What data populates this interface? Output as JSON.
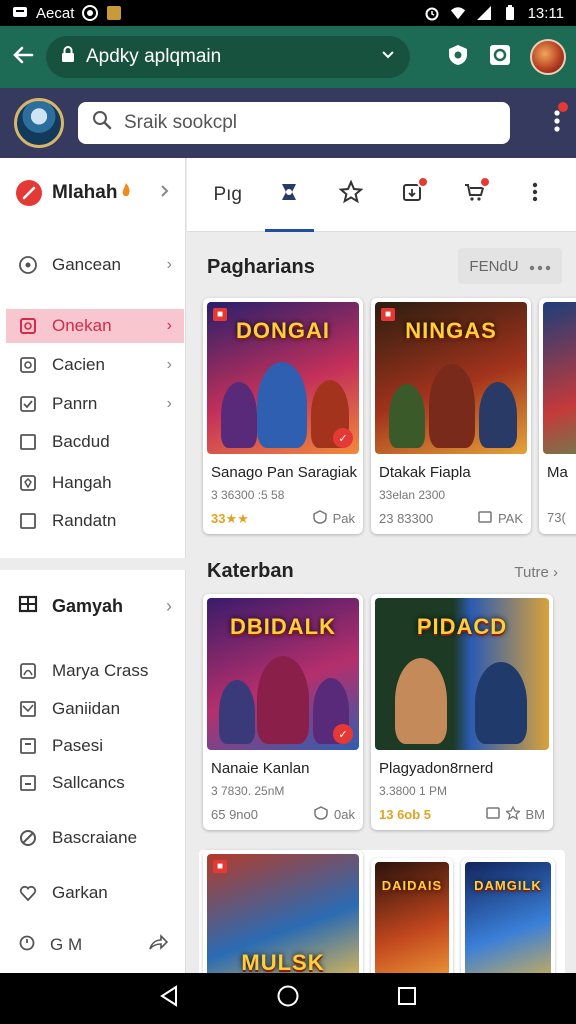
{
  "status_bar": {
    "left_text": "Aecat",
    "time": "13:11"
  },
  "app_bar": {
    "url": "Apdky aplqmain"
  },
  "search": {
    "placeholder": "Sraik sookcpl"
  },
  "sidebar": {
    "brand": "Mlahah",
    "items": [
      {
        "label": "Gancean",
        "icon": "chat-icon",
        "chevron": true
      },
      {
        "label": "Onekan",
        "icon": "square-icon",
        "chevron": true,
        "active": true
      },
      {
        "label": "Cacien",
        "icon": "square-icon",
        "chevron": true
      },
      {
        "label": "Panrn",
        "icon": "check-square-icon",
        "chevron": true
      },
      {
        "label": "Bacdud",
        "icon": "square-icon",
        "chevron": false
      },
      {
        "label": "Hangah",
        "icon": "shield-square-icon",
        "chevron": false
      },
      {
        "label": "Randatn",
        "icon": "square-icon",
        "chevron": false
      }
    ],
    "section": {
      "label": "Gamyah"
    },
    "sub_items": [
      {
        "label": "Marya Crass",
        "icon": "tag-icon"
      },
      {
        "label": "Ganiidan",
        "icon": "image-icon"
      },
      {
        "label": "Pasesi",
        "icon": "square-icon"
      },
      {
        "label": "Sallcancs",
        "icon": "square-icon"
      },
      {
        "label": "Bascraiane",
        "icon": "ban-icon"
      },
      {
        "label": "Garkan",
        "icon": "heart-icon"
      }
    ],
    "bottom_label": "G M"
  },
  "tabs": [
    {
      "label": "Pıg",
      "icon": "text-tab"
    },
    {
      "label": "",
      "icon": "ribbon-icon",
      "active": true
    },
    {
      "label": "",
      "icon": "star-icon"
    },
    {
      "label": "",
      "icon": "download-icon",
      "badge": true
    },
    {
      "label": "",
      "icon": "cart-icon",
      "badge": true
    },
    {
      "label": "",
      "icon": "more-icon"
    }
  ],
  "section1": {
    "title": "Pagharians",
    "filter": "FENdU",
    "cards": [
      {
        "art_title": "DONGAI",
        "title": "Sanago Pan Saragiak",
        "sub": "3 36300 :5 58",
        "rating": "33★★",
        "action": "Pak",
        "palette": [
          "#2a1f6b",
          "#c4305a",
          "#f08a3c"
        ]
      },
      {
        "art_title": "NINGAS",
        "title": "Dtakak Fiapla",
        "sub": "33elan 2300",
        "rating": "23 83300",
        "action": "PAK",
        "palette": [
          "#2b1d10",
          "#a3331c",
          "#e5a23a"
        ]
      },
      {
        "art_title": "",
        "title": "Ma",
        "sub": "",
        "rating": "",
        "action": "73(",
        "palette": [
          "#1c3e7a",
          "#c43a3a",
          "#3aa55c"
        ]
      }
    ]
  },
  "section2": {
    "title": "Katerban",
    "see_all": "Tutre",
    "cards": [
      {
        "art_title": "DBIDALK",
        "title": "Nanaie Kanlan",
        "sub": "3 7830. 25nM",
        "rating": "65 9no0",
        "action": "0ak",
        "palette": [
          "#3a1b6b",
          "#b52f6b",
          "#2f5fb0"
        ]
      },
      {
        "art_title": "PIDACD",
        "title": "Plagyadon8rnerd",
        "sub": "3.3800 1 PM",
        "rating": "13 6ob 5",
        "action": "BM",
        "palette": [
          "#1d3a24",
          "#2b5bb3",
          "#d8a23a"
        ]
      }
    ]
  },
  "section3": {
    "cards": [
      {
        "art_title": "MULSK",
        "palette": [
          "#b33b2a",
          "#2a6bb3",
          "#f2c14a"
        ]
      },
      {
        "art_title": "DAIDAIS",
        "palette": [
          "#2a120c",
          "#c2471e",
          "#f3a53a"
        ]
      },
      {
        "art_title": "DAMGILK",
        "palette": [
          "#12245c",
          "#3a7fd8",
          "#e2b543"
        ]
      }
    ]
  }
}
